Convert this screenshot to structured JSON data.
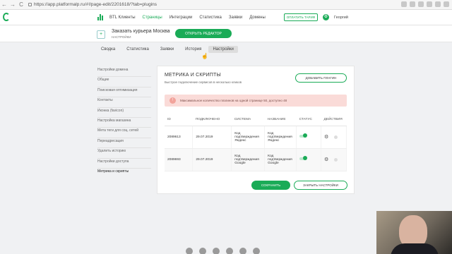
{
  "browser": {
    "back": "←",
    "forward": "→",
    "reload": "C",
    "url": "https://app.platformalp.ru/#!/page-edit/2201618/?tab=plugins"
  },
  "topnav": {
    "brand": "BTL Клиенты",
    "menu": [
      "Страницы",
      "Интеграции",
      "Статистика",
      "Заявки",
      "Домены"
    ],
    "pay_button": "ОПЛАТИТЬ ТАРИФ",
    "gear_glyph": "⚙",
    "user": "Георгий"
  },
  "subheader": {
    "icon_glyph": "+",
    "title": "Заказать курьера Москва",
    "subtitle": "НАСТРОЙКИ",
    "editor_button": "ОТКРЫТЬ РЕДАКТОР"
  },
  "tabs": [
    "Сводка",
    "Статистика",
    "Заявки",
    "История",
    "Настройки"
  ],
  "cursor_glyph": "☝",
  "sidebar": [
    "Настройки домена",
    "Общие",
    "Поисковая оптимизация",
    "Контакты",
    "Иконка (favicon)",
    "Настройка магазина",
    "Мета теги для соц. сетей",
    "Переадресация",
    "Удалить историю",
    "Настройки доступа",
    "Метрика и скрипты"
  ],
  "card": {
    "title": "МЕТРИКА И СКРИПТЫ",
    "subtitle": "Быстрое подключение сервисов в несколько кликов",
    "add_button": "ДОБАВИТЬ ПЛАГИН",
    "alert_glyph": "!",
    "alert": "Максимальное количество плагинов на одной странице 50, доступно 48",
    "columns": [
      "ID",
      "ПОДКЛЮЧЕНО",
      "СИСТЕМА",
      "НАЗВАНИЕ",
      "СТАТУС",
      "ДЕЙСТВИЯ"
    ],
    "rows": [
      {
        "id": "2089613",
        "date": "29.07.2019",
        "system": "Код подтверждения Яндекс",
        "name": "Код подтверждения Яндекс",
        "gear": "⚙"
      },
      {
        "id": "2089693",
        "date": "29.07.2019",
        "system": "Код подтверждения Google",
        "name": "Код подтверждения Google",
        "gear": "⚙"
      }
    ],
    "save_button": "СОХРАНИТЬ",
    "close_button": "ЗАКРЫТЬ НАСТРОЙКИ"
  }
}
